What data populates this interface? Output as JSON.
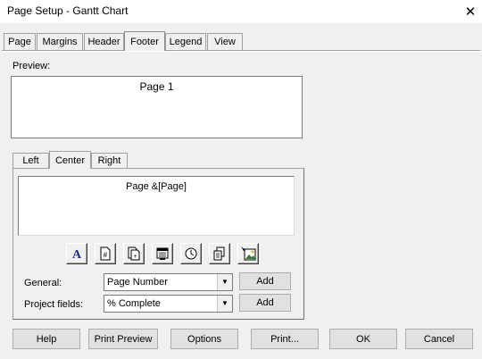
{
  "window": {
    "title": "Page Setup - Gantt Chart",
    "close_glyph": "✕"
  },
  "tabs": [
    "Page",
    "Margins",
    "Header",
    "Footer",
    "Legend",
    "View"
  ],
  "active_tab": "Footer",
  "preview": {
    "label": "Preview:",
    "text": "Page 1"
  },
  "alignment_tabs": [
    "Left",
    "Center",
    "Right"
  ],
  "active_alignment_tab": "Center",
  "footer_text": "Page &[Page]",
  "toolbar_icons": [
    "format-text-font-icon",
    "insert-page-number-icon",
    "insert-total-page-count-icon",
    "insert-current-date-icon",
    "insert-current-time-icon",
    "insert-file-name-icon",
    "insert-picture-icon"
  ],
  "general": {
    "label": "General:",
    "value": "Page Number",
    "add_label": "Add"
  },
  "project_fields": {
    "label": "Project fields:",
    "value": "% Complete",
    "add_label": "Add"
  },
  "buttons": {
    "help": "Help",
    "print_preview": "Print Preview",
    "options": "Options",
    "print": "Print...",
    "ok": "OK",
    "cancel": "Cancel"
  },
  "combo_arrow_glyph": "▼"
}
